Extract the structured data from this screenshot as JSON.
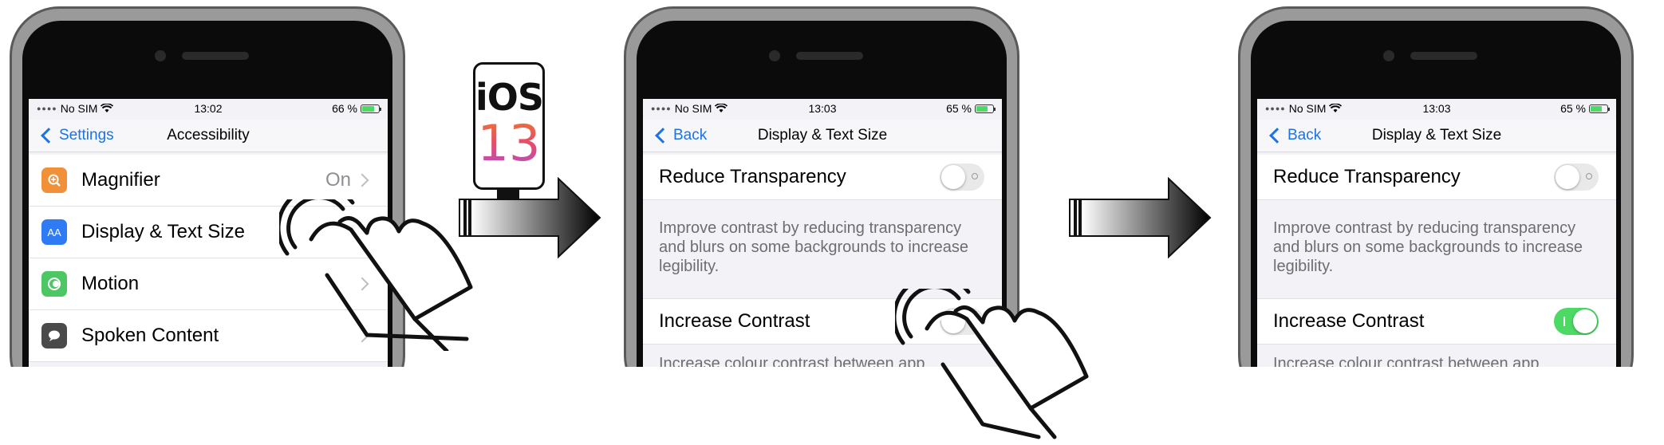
{
  "ios_badge": {
    "word": "iOS",
    "number": "13"
  },
  "phones": [
    {
      "status": {
        "carrier": "No SIM",
        "time": "13:02",
        "battery": "66 %",
        "battery_level": 0.66
      },
      "nav": {
        "back": "Settings",
        "title": "Accessibility"
      },
      "items": [
        {
          "label": "Magnifier",
          "value": "On",
          "icon": "magnifier-icon",
          "color": "#f0913a"
        },
        {
          "label": "Display & Text Size",
          "value": "",
          "icon": "text-size-icon",
          "color": "#2f7bf5",
          "glyph": "AA"
        },
        {
          "label": "Motion",
          "value": "",
          "icon": "motion-icon",
          "color": "#4cc764"
        },
        {
          "label": "Spoken Content",
          "value": "",
          "icon": "speech-icon",
          "color": "#4a4a4a"
        }
      ]
    },
    {
      "status": {
        "carrier": "No SIM",
        "time": "13:03",
        "battery": "65 %",
        "battery_level": 0.65
      },
      "nav": {
        "back": "Back",
        "title": "Display & Text Size"
      },
      "reduce_transparency": {
        "label": "Reduce Transparency",
        "on": false
      },
      "reduce_transparency_desc": "Improve contrast by reducing transparency and blurs on some backgrounds to increase legibility.",
      "increase_contrast": {
        "label": "Increase Contrast",
        "on": false
      },
      "increase_contrast_desc": "Increase colour contrast between app"
    },
    {
      "status": {
        "carrier": "No SIM",
        "time": "13:03",
        "battery": "65 %",
        "battery_level": 0.65
      },
      "nav": {
        "back": "Back",
        "title": "Display & Text Size"
      },
      "reduce_transparency": {
        "label": "Reduce Transparency",
        "on": false
      },
      "reduce_transparency_desc": "Improve contrast by reducing transparency and blurs on some backgrounds to increase legibility.",
      "increase_contrast": {
        "label": "Increase Contrast",
        "on": true
      },
      "increase_contrast_desc": "Increase colour contrast between app"
    }
  ],
  "colors": {
    "accent": "#1a73e8",
    "toggle_on": "#4cd964"
  }
}
